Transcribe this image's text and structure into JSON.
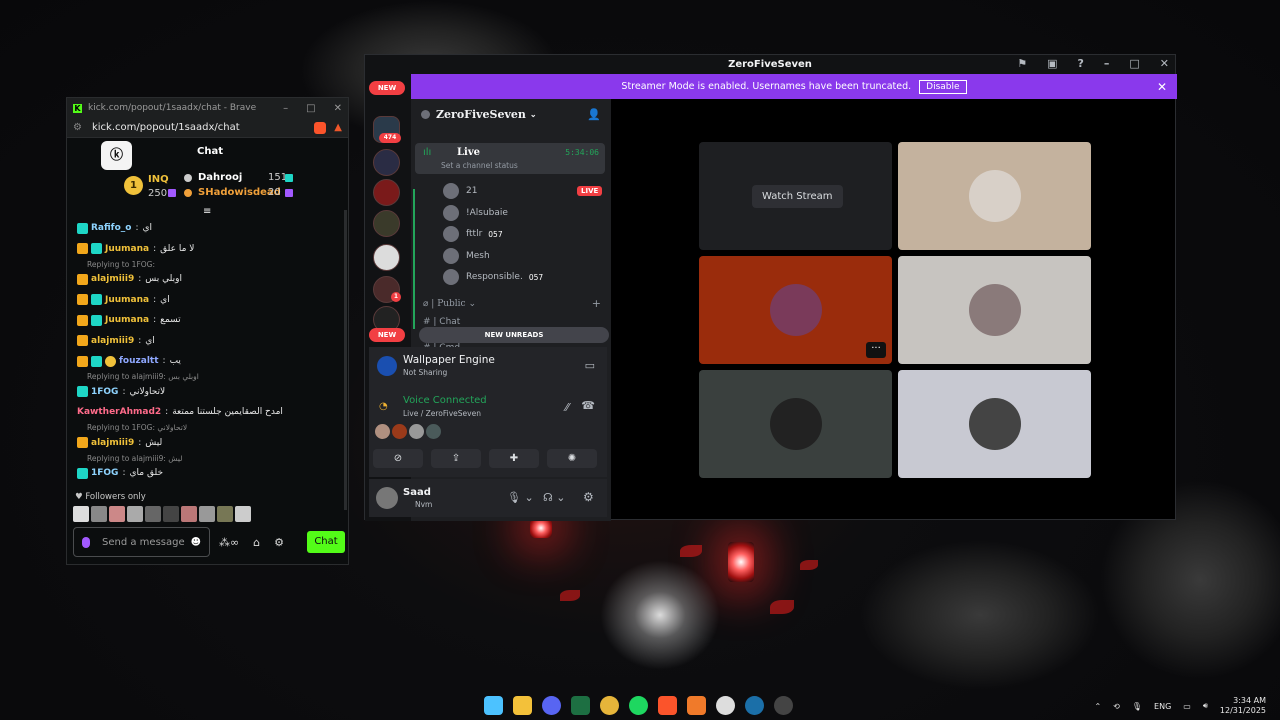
{
  "kick_window": {
    "title": "kick.com/popout/1saadx/chat - Brave",
    "url": "kick.com/popout/1saadx/chat",
    "header_title": "Chat",
    "logo_text": "ⓚ",
    "leaderboard": {
      "rank": "1",
      "left_name": "INQ",
      "left_count": "250",
      "entries": [
        {
          "name": "Dahrooj",
          "count": "151",
          "color": "#ffffff"
        },
        {
          "name": "SHadowisdead",
          "count": "20",
          "color": "#f0a03a"
        }
      ]
    },
    "messages": [
      {
        "type": "msg",
        "badges": [
          "teal"
        ],
        "user": "Rafifo_o",
        "user_color": "#8fd4ff",
        "text": "اي"
      },
      {
        "type": "msg",
        "badges": [
          "crown",
          "teal"
        ],
        "user": "Juumana",
        "user_color": "#f0c13a",
        "text": "لا ما علق"
      },
      {
        "type": "reply",
        "text": "Replying to 1FOG:"
      },
      {
        "type": "msg",
        "badges": [
          "crown"
        ],
        "user": "alajmiii9",
        "user_color": "#f0c13a",
        "text": "اوبلي بس"
      },
      {
        "type": "msg",
        "badges": [
          "crown",
          "teal"
        ],
        "user": "Juumana",
        "user_color": "#f0c13a",
        "text": "اي"
      },
      {
        "type": "msg",
        "badges": [
          "crown",
          "teal"
        ],
        "user": "Juumana",
        "user_color": "#f0c13a",
        "text": "تسمع"
      },
      {
        "type": "msg",
        "badges": [
          "crown"
        ],
        "user": "alajmiii9",
        "user_color": "#f0c13a",
        "text": "اي"
      },
      {
        "type": "msg",
        "badges": [
          "crown",
          "teal",
          "gold"
        ],
        "user": "fouzaltt",
        "user_color": "#8fa8ff",
        "text": "يب"
      },
      {
        "type": "reply",
        "text": "Replying to alajmiii9: اوبلي بس"
      },
      {
        "type": "msg",
        "badges": [
          "teal"
        ],
        "user": "1FOG",
        "user_color": "#8fd4ff",
        "text": "لاتحاولاني"
      },
      {
        "type": "msg",
        "badges": [],
        "user": "KawtherAhmad2",
        "user_color": "#ff6b8a",
        "text": "امدح الصقايمين جلستنا ممتعة"
      },
      {
        "type": "reply",
        "text": "Replying to 1FOG: لاتحاولاني"
      },
      {
        "type": "msg",
        "badges": [
          "crown"
        ],
        "user": "alajmiii9",
        "user_color": "#f0c13a",
        "text": "ليش"
      },
      {
        "type": "reply",
        "text": "Replying to alajmiii9: ليش"
      },
      {
        "type": "msg",
        "badges": [
          "teal"
        ],
        "user": "1FOG",
        "user_color": "#8fd4ff",
        "text": "خلق ماي"
      }
    ],
    "followers_only": "Followers only",
    "input_placeholder": "Send a message",
    "send_label": "Chat",
    "accent_color": "#53fc18"
  },
  "discord": {
    "window_title": "ZeroFiveSeven",
    "streamer_banner": "Streamer Mode is enabled. Usernames have been truncated.",
    "disable_label": "Disable",
    "new_label": "NEW",
    "badge_474": "474",
    "badge_1": "1",
    "server_name": "ZeroFiveSeven",
    "live_channel": {
      "name": "Live",
      "timer": "5:34:06",
      "status": "Set a channel status"
    },
    "voice_users": [
      {
        "name": "21",
        "live": true
      },
      {
        "name": "!Alsubaie",
        "live": false
      },
      {
        "name": "fttlr",
        "tag": "057",
        "live": false
      },
      {
        "name": "Mesh",
        "live": false
      },
      {
        "name": "Responsible.",
        "tag": "057",
        "live": false
      }
    ],
    "live_tag": "LIVE",
    "category_public": "Public",
    "channel_chat": "Chat",
    "channel_cmd": "Cmd",
    "new_unreads": "NEW UNREADS",
    "activity": {
      "title": "Wallpaper Engine",
      "subtitle": "Not Sharing"
    },
    "voice_connected": {
      "title": "Voice Connected",
      "subtitle": "Live / ZeroFiveSeven"
    },
    "user": {
      "name": "Saad",
      "status": "Nvm"
    },
    "watch_stream": "Watch Stream",
    "banner_color": "#8a39ec",
    "tiles": [
      {
        "bg": "#1e1f22",
        "watch": true
      },
      {
        "bg": "#c4b29e"
      },
      {
        "bg": "#9a2c0c",
        "more": "···"
      },
      {
        "bg": "#c7c4c0"
      },
      {
        "bg": "#3a403e"
      },
      {
        "bg": "#c8c9d2"
      }
    ]
  },
  "taskbar": {
    "lang": "ENG",
    "time": "3:34 AM",
    "date": "12/31/2025"
  }
}
